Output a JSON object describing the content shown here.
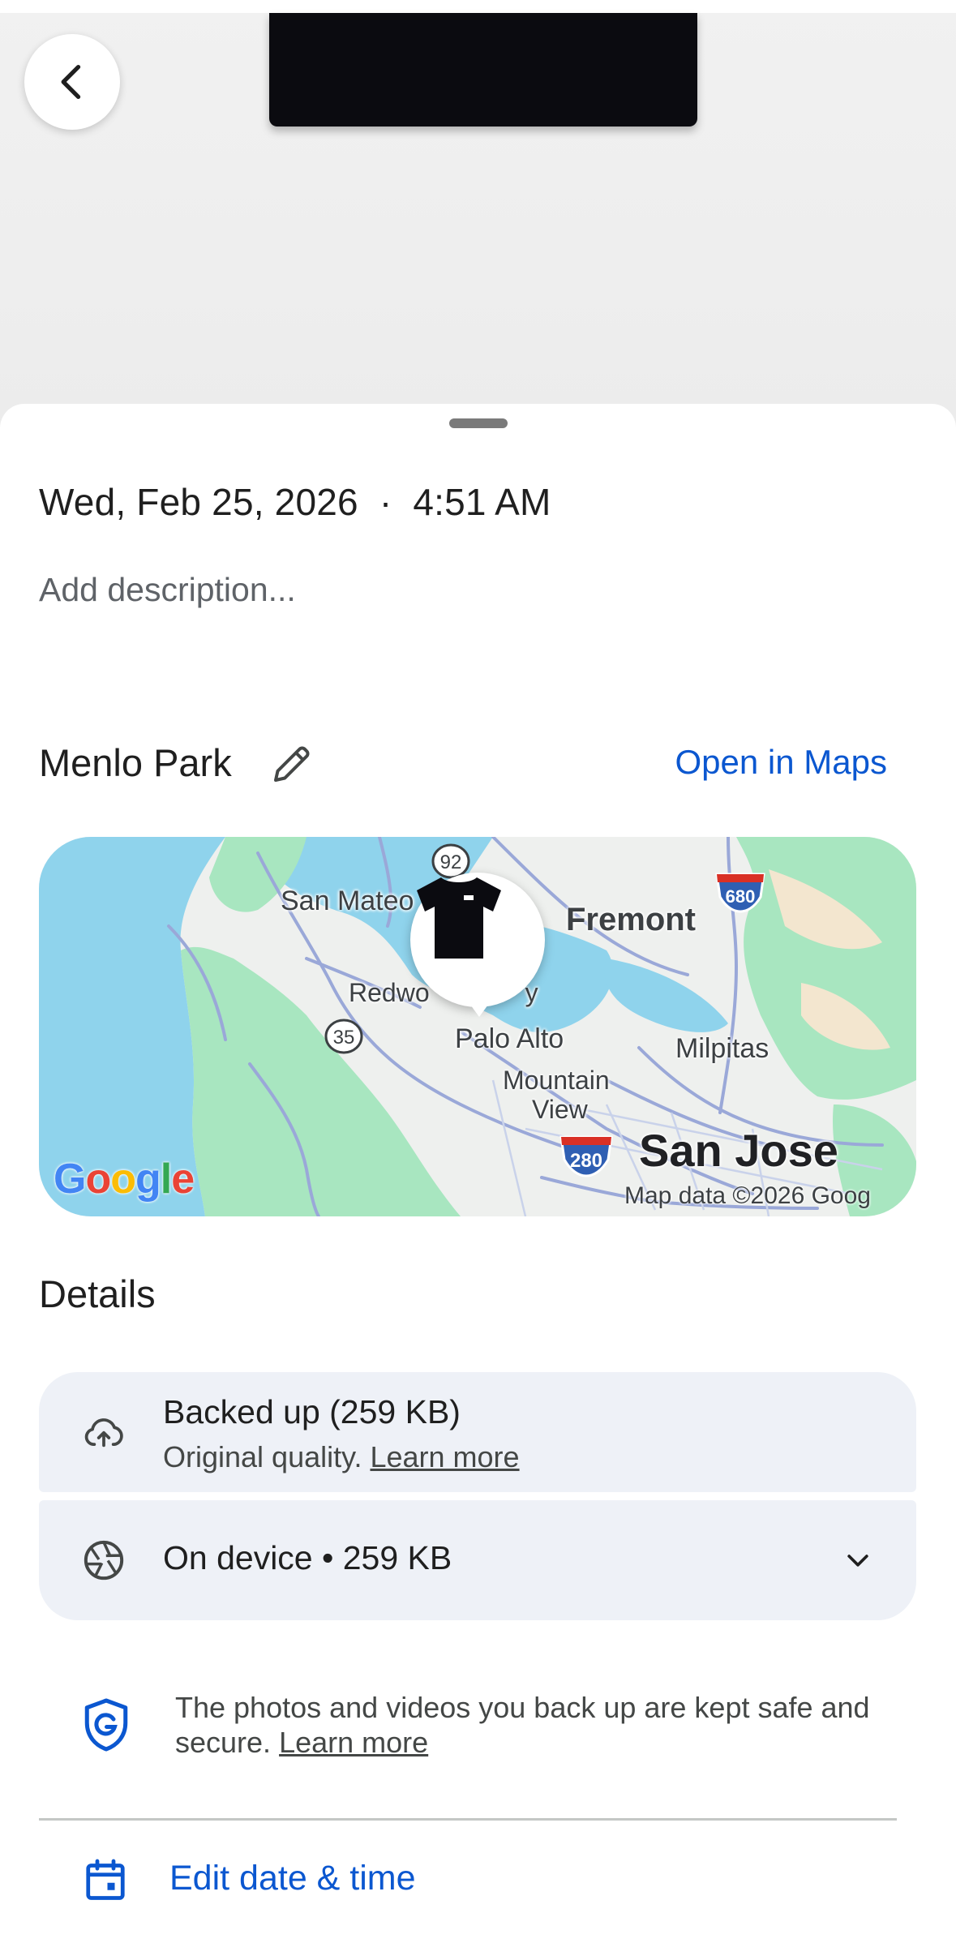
{
  "photo": {
    "subject": "black t-shirt"
  },
  "header": {
    "back_icon": "arrow-back-icon"
  },
  "info": {
    "date": "Wed, Feb 25, 2026",
    "separator": "·",
    "time": "4:51 AM",
    "description_placeholder": "Add description..."
  },
  "location": {
    "place_name": "Menlo Park",
    "edit_icon": "pencil-icon",
    "open_maps_label": "Open in Maps"
  },
  "map": {
    "labels": {
      "san_mateo": "San Mateo",
      "fremont": "Fremont",
      "redwood": "Redwo",
      "redwood_tail": "y",
      "palo_alto": "Palo Alto",
      "milpitas": "Milpitas",
      "mountain": "Mountain",
      "view": "View",
      "san_jose": "San Jose"
    },
    "shields": {
      "r92": "92",
      "r680": "680",
      "r35": "35",
      "r280": "280"
    },
    "logo": {
      "G": "G",
      "o1": "o",
      "o2": "o",
      "g": "g",
      "l": "l",
      "e": "e"
    },
    "attribution": "Map data ©2026 Goog"
  },
  "details": {
    "title": "Details",
    "backup": {
      "icon": "cloud-upload-icon",
      "title": "Backed up (259 KB)",
      "subtitle": "Original quality.",
      "learn_more": "Learn more"
    },
    "device": {
      "icon": "camera-aperture-icon",
      "title": "On device • 259 KB",
      "chevron": "chevron-down-icon"
    }
  },
  "safety": {
    "icon": "shield-icon",
    "text": "The photos and videos you back up are kept safe and secure.",
    "learn_more": "Learn more"
  },
  "actions": {
    "edit_date_icon": "calendar-icon",
    "edit_date_label": "Edit date & time"
  },
  "colors": {
    "accent": "#0b57d0",
    "card_bg": "#eef1f7",
    "water": "#8fd3ec",
    "park": "#a8e6c0"
  }
}
